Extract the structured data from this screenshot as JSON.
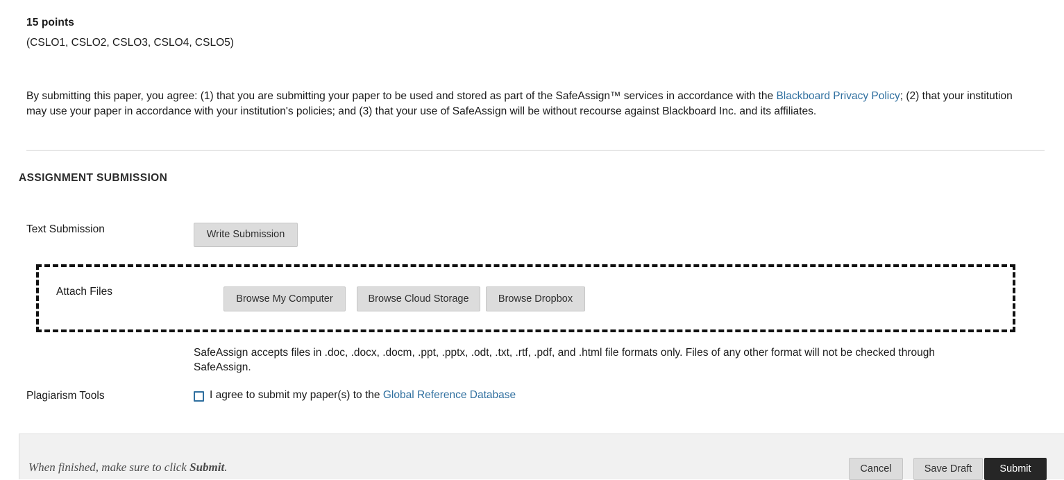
{
  "intro": {
    "points": "15 points",
    "outcomes": "(CSLO1, CSLO2, CSLO3, CSLO4, CSLO5)",
    "agreement_part1": "By submitting this paper, you agree: (1) that you are submitting your paper to be used and stored as part of the SafeAssign™ services in accordance with the ",
    "agreement_link": "Blackboard Privacy Policy",
    "agreement_part2": "; (2) that your institution may use your paper in accordance with your institution's policies; and (3) that your use of SafeAssign will be without recourse against Blackboard Inc. and its affiliates."
  },
  "section": {
    "title": "ASSIGNMENT SUBMISSION"
  },
  "text_submission": {
    "label": "Text Submission",
    "write_button": "Write Submission"
  },
  "attach_files": {
    "label": "Attach Files",
    "browse_my_computer": "Browse My Computer",
    "browse_cloud_storage": "Browse Cloud Storage",
    "browse_dropbox": "Browse Dropbox"
  },
  "safeassign_note": "SafeAssign accepts files in .doc, .docx, .docm, .ppt, .pptx, .odt, .txt, .rtf, .pdf, and .html file formats only. Files of any other format will not be checked through SafeAssign.",
  "plagiarism_tools": {
    "label": "Plagiarism Tools",
    "agree_text_before": "I agree to submit my paper(s) to the ",
    "agree_link": "Global Reference Database",
    "checked": false
  },
  "action_bar": {
    "note_before": "When finished, make sure to click ",
    "note_bold": "Submit",
    "note_after": ".",
    "cancel": "Cancel",
    "save_draft": "Save Draft",
    "submit": "Submit"
  },
  "colors": {
    "link": "#2f6f9f",
    "checkbox_border": "#2f6f9f",
    "button_face": "#dcdcdc",
    "submit_button": "#262626",
    "action_bar_bg": "#f1f1f1",
    "dashed_border": "#111111"
  }
}
